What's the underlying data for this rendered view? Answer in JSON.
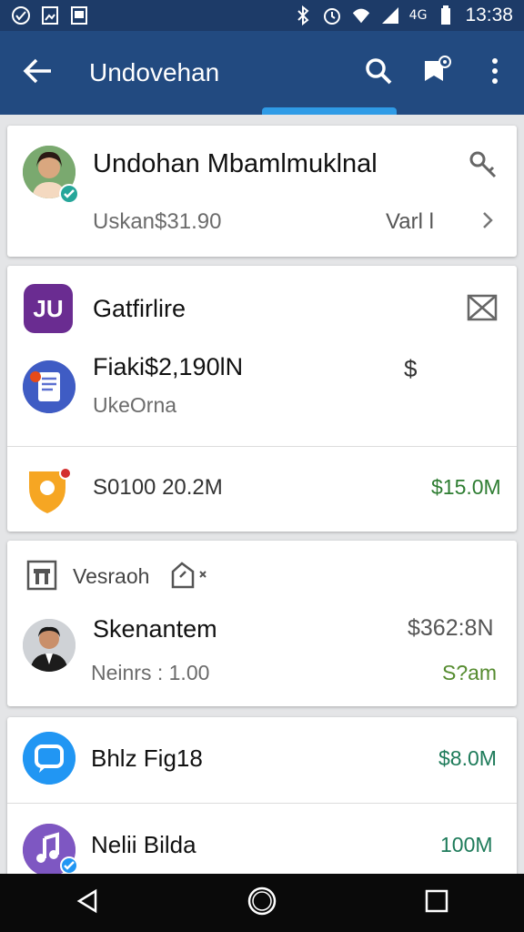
{
  "status_bar": {
    "left_icons": [
      "check-circle-icon",
      "photo-icon",
      "image-icon"
    ],
    "right_icons": [
      "bluetooth-icon",
      "alarm-icon",
      "wifi-icon",
      "signal-icon"
    ],
    "network_text": "4G",
    "battery_icon": "battery-icon",
    "time": "13:38"
  },
  "app_bar": {
    "title": "Undovehan",
    "actions": [
      "search-icon",
      "flag-icon",
      "more-vert-icon"
    ],
    "accent": "#2f9be6",
    "background": "#224a80"
  },
  "card1": {
    "name": "Undohan Mbamlmuklnal",
    "sub": "Uskan$31.90",
    "side_text": "Varl l"
  },
  "card2": {
    "app_title": "Gatfirlire",
    "app_icon_text": "JU",
    "item1": {
      "title": "Fiaki$2,190lN",
      "sub": "UkeOrna",
      "trailing": "$"
    },
    "item2": {
      "title": "S0100 20.2M",
      "value": "$15.0M"
    }
  },
  "card3": {
    "header": "Vesraoh",
    "person": {
      "name": "Skenantem",
      "sub": "Neinrs : 1.00",
      "value_top": "$362:8N",
      "value_bottom": "S?am"
    }
  },
  "card4": {
    "item1": {
      "title": "Bhlz Fig18",
      "value": "$8.0M"
    },
    "item2": {
      "title": "Nelii Bilda",
      "value": "100M"
    }
  },
  "colors": {
    "green": "#2e7d32",
    "blue": "#2196f3",
    "purple": "#6a2c91"
  }
}
